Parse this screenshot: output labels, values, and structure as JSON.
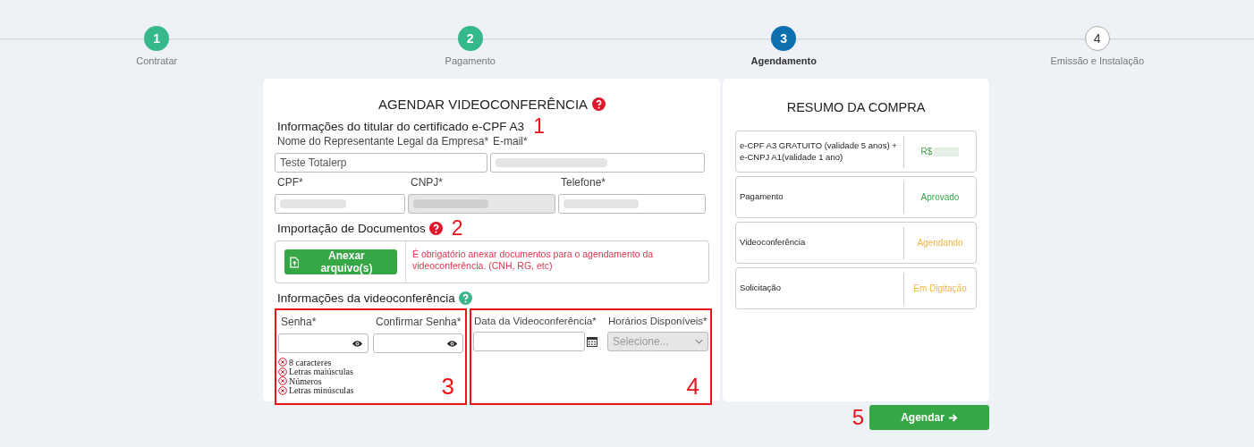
{
  "steps": [
    {
      "number": "1",
      "label": "Contratar",
      "completed": true,
      "selected": false
    },
    {
      "number": "2",
      "label": "Pagamento",
      "completed": true,
      "selected": false
    },
    {
      "number": "3",
      "label": "Agendamento",
      "selected": true
    },
    {
      "number": "4",
      "label": "Emissão e Instalação",
      "completed": false,
      "selected": false
    }
  ],
  "form": {
    "title": "AGENDAR VIDEOCONFERÊNCIA",
    "holder": {
      "heading": "Informações do titular do certificado e-CPF A3",
      "annotation": "1",
      "fields": [
        {
          "label": "Nome do Representante Legal da Empresa*",
          "value": "Teste Totalerp",
          "redacted": false,
          "disabled": false
        },
        {
          "label": "E-mail*",
          "redacted": true,
          "disabled": false
        },
        {
          "label": "CPF*",
          "redacted": true,
          "disabled": false
        },
        {
          "label": "CNPJ*",
          "redacted": true,
          "disabled": true
        },
        {
          "label": "Telefone*",
          "redacted": true,
          "disabled": false
        }
      ]
    },
    "documents": {
      "heading": "Importação de Documentos",
      "annotation": "2",
      "button": "Anexar arquivo(s)",
      "notice": "É obrigatório anexar documentos para o agendamento da videoconferência. (CNH, RG, etc)"
    },
    "video": {
      "heading": "Informações da videoconferência",
      "password": {
        "annotation": "3",
        "highlighted": true,
        "fields": [
          {
            "label": "Senha*"
          },
          {
            "label": "Confirmar Senha*"
          }
        ],
        "rules": [
          {
            "text": "8 caracteres",
            "checked": false
          },
          {
            "text": "Letras maiúsculas",
            "checked": false
          },
          {
            "text": "Números",
            "checked": false
          },
          {
            "text": "Letras minúsculas",
            "checked": false
          }
        ]
      },
      "schedule": {
        "annotation": "4",
        "highlighted": true,
        "date_label": "Data da Videoconferência*",
        "time_label": "Horários Disponíveis*",
        "time_placeholder": "Selecione...",
        "time_disabled": true
      }
    }
  },
  "summary": {
    "title": "RESUMO DA COMPRA",
    "rows": [
      {
        "label": "e-CPF A3 GRATUITO (validade 5 anos) + e-CNPJ A1(validade 1 ano)",
        "value": "R$",
        "redacted": true,
        "color": "#3aa64a"
      },
      {
        "label": "Pagamento",
        "value": "Aprovado",
        "redacted": false,
        "color": "#3aa64a"
      },
      {
        "label": "Videoconferência",
        "value": "Agendando",
        "redacted": false,
        "color": "#f2b441"
      },
      {
        "label": "Solicitação",
        "value": "Em Digitação",
        "redacted": false,
        "color": "#f2b441"
      }
    ]
  },
  "submit": {
    "annotation": "5",
    "label": "Agendar"
  }
}
